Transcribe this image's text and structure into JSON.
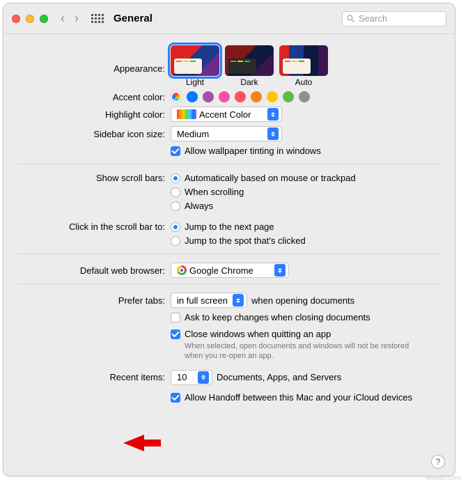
{
  "window": {
    "title": "General",
    "search_placeholder": "Search"
  },
  "appearance": {
    "label": "Appearance:",
    "options": [
      "Light",
      "Dark",
      "Auto"
    ],
    "selected": "Light"
  },
  "accent": {
    "label": "Accent color:",
    "colors": [
      "#007aff",
      "#a550a7",
      "#f74f9e",
      "#ff5257",
      "#f7821b",
      "#ffc600",
      "#62ba46",
      "#8e8e93"
    ]
  },
  "highlight": {
    "label": "Highlight color:",
    "value": "Accent Color"
  },
  "sidebar_size": {
    "label": "Sidebar icon size:",
    "value": "Medium"
  },
  "wallpaper_tint": {
    "label": "Allow wallpaper tinting in windows",
    "checked": true
  },
  "scrollbars": {
    "label": "Show scroll bars:",
    "options": [
      "Automatically based on mouse or trackpad",
      "When scrolling",
      "Always"
    ],
    "selected": 0
  },
  "scrollclick": {
    "label": "Click in the scroll bar to:",
    "options": [
      "Jump to the next page",
      "Jump to the spot that's clicked"
    ],
    "selected": 0
  },
  "browser": {
    "label": "Default web browser:",
    "value": "Google Chrome"
  },
  "tabs": {
    "label": "Prefer tabs:",
    "value": "in full screen",
    "suffix": "when opening documents"
  },
  "ask_keep": {
    "label": "Ask to keep changes when closing documents",
    "checked": false
  },
  "close_win": {
    "label": "Close windows when quitting an app",
    "checked": true,
    "hint": "When selected, open documents and windows will not be restored when you re-open an app."
  },
  "recent": {
    "label": "Recent items:",
    "value": "10",
    "suffix": "Documents, Apps, and Servers"
  },
  "handoff": {
    "label": "Allow Handoff between this Mac and your iCloud devices",
    "checked": true
  },
  "watermark": "wsxdn.com"
}
